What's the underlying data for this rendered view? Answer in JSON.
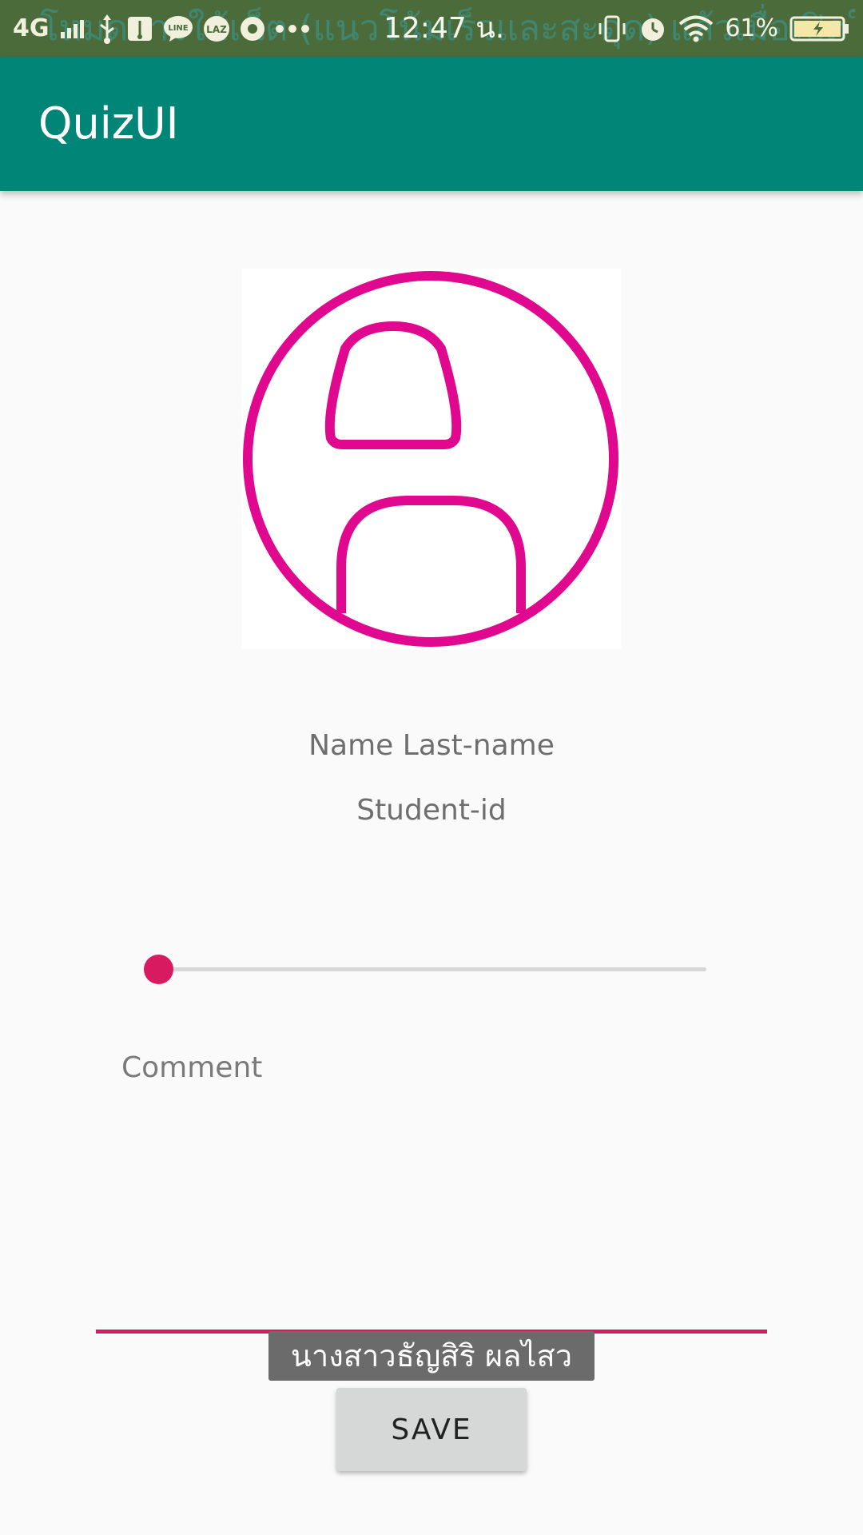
{
  "status_bar": {
    "overlay_text": "โหมดการใช้เน็ต (แนวโน้มเร็วและสะดุด) แล้วเมื่อเปิดใช้งาน",
    "network": "4G",
    "time": "12:47 น.",
    "battery": "61%",
    "icons": [
      "signal-icon",
      "usb-icon",
      "usb-debug-icon",
      "line-icon",
      "lazada-icon",
      "notification-icon",
      "more-icon",
      "vibrate-icon",
      "alarm-icon",
      "wifi-icon",
      "battery-icon"
    ]
  },
  "app_bar": {
    "title": "QuizUI",
    "color": "#008577"
  },
  "profile": {
    "avatar_icon": "person-avatar-icon",
    "avatar_color": "#e0088f",
    "name": "Name Last-name",
    "student_id": "Student-id"
  },
  "slider": {
    "value": 0,
    "accent": "#d81b60"
  },
  "comment": {
    "placeholder": "Comment"
  },
  "toast": {
    "text": "นางสาวธัญสิริ ผลไสว"
  },
  "actions": {
    "save_label": "SAVE"
  }
}
